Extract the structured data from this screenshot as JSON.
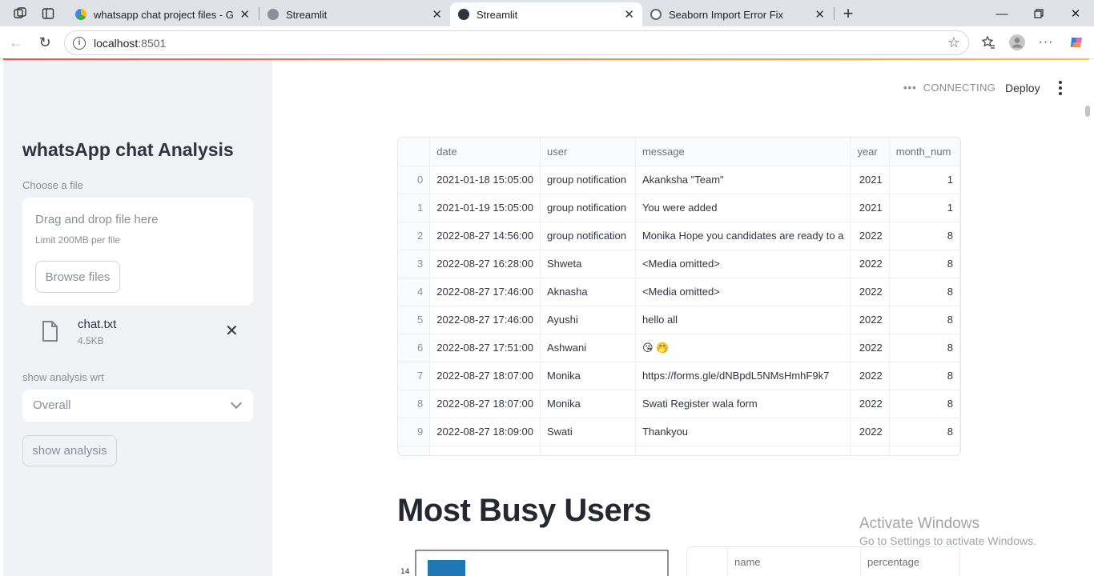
{
  "browser": {
    "tabs": [
      {
        "title": "whatsapp chat project files - Goo",
        "favicon_color": "#4285f4",
        "active": false
      },
      {
        "title": "Streamlit",
        "favicon_color": "#7b7f8a",
        "active": false
      },
      {
        "title": "Streamlit",
        "favicon_color": "#31333f",
        "active": true
      },
      {
        "title": "Seaborn Import Error Fix",
        "favicon_color": "#777",
        "active": false
      }
    ],
    "url_host": "localhost",
    "url_port": ":8501"
  },
  "sidebar": {
    "title": "whatsApp chat Analysis",
    "uploader_label": "Choose a file",
    "drag_drop_text": "Drag and drop file here",
    "limit_text": "Limit 200MB per file",
    "browse_label": "Browse files",
    "file_name": "chat.txt",
    "file_size": "4.5KB",
    "select_label": "show analysis wrt",
    "select_value": "Overall",
    "show_analysis_label": "show analysis"
  },
  "header": {
    "status": "CONNECTING",
    "deploy": "Deploy"
  },
  "dataframe": {
    "columns": [
      "",
      "date",
      "user",
      "message",
      "year",
      "month_num"
    ],
    "rows": [
      [
        "0",
        "2021-01-18 15:05:00",
        "group notification",
        "Akanksha \"Team\"",
        "2021",
        "1"
      ],
      [
        "1",
        "2021-01-19 15:05:00",
        "group notification",
        "You were added",
        "2021",
        "1"
      ],
      [
        "2",
        "2022-08-27 14:56:00",
        "group notification",
        "Monika  Hope you candidates are ready to a",
        "2022",
        "8"
      ],
      [
        "3",
        "2022-08-27 16:28:00",
        "Shweta",
        "<Media omitted>",
        "2022",
        "8"
      ],
      [
        "4",
        "2022-08-27 17:46:00",
        "Aknasha",
        "<Media omitted>",
        "2022",
        "8"
      ],
      [
        "5",
        "2022-08-27 17:46:00",
        "Ayushi",
        "hello all",
        "2022",
        "8"
      ],
      [
        "6",
        "2022-08-27 17:51:00",
        "Ashwani",
        "😘 🤭",
        "2022",
        "8"
      ],
      [
        "7",
        "2022-08-27 18:07:00",
        "Monika",
        "https://forms.gle/dNBpdL5NMsHmhF9k7",
        "2022",
        "8"
      ],
      [
        "8",
        "2022-08-27 18:07:00",
        "Monika",
        "Swati  Register wala form",
        "2022",
        "8"
      ],
      [
        "9",
        "2022-08-27 18:09:00",
        "Swati",
        "Thankyou",
        "2022",
        "8"
      ]
    ]
  },
  "section_heading": "Most Busy Users",
  "chart_data": {
    "type": "bar",
    "y_tick_visible": "14",
    "bar_color": "#1f77b4"
  },
  "busy_table": {
    "columns": [
      "",
      "name",
      "percentage"
    ]
  },
  "watermark": {
    "line1": "Activate Windows",
    "line2": "Go to Settings to activate Windows."
  }
}
